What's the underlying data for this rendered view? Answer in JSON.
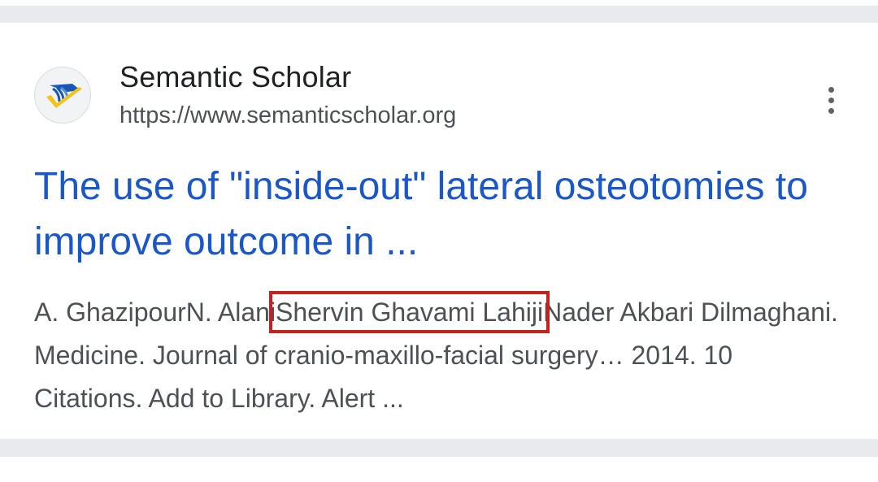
{
  "result": {
    "site_name": "Semantic Scholar",
    "site_url": "https://www.semanticscholar.org",
    "favicon_icon": "semantic-scholar-logo-icon",
    "more_icon": "more-vert-icon",
    "title": "The use of \"inside-out\" lateral osteotomies to improve outcome in ...",
    "snippet": {
      "before": "A. GhazipourN. Alani",
      "highlighted": "Shervin Ghavami Lahiji",
      "after": "Nader Akbari Dilmaghani. Medicine. Journal of cranio-maxillo-facial surgery… 2014. 10 Citations. Add to Library. Alert ..."
    }
  },
  "colors": {
    "title_link": "#1a57c9",
    "highlight_box": "#c5221f",
    "separator": "#e8eaed"
  }
}
